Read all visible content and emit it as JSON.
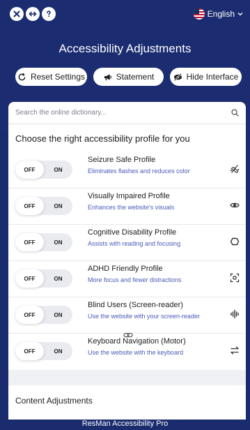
{
  "header": {
    "language": "English",
    "title": "Accessibility Adjustments",
    "buttons": {
      "reset": "Reset Settings",
      "statement": "Statement",
      "hide": "Hide Interface"
    }
  },
  "search": {
    "placeholder": "Search the online dictionary..."
  },
  "profiles": {
    "heading": "Choose the right accessibility profile for you",
    "off_label": "OFF",
    "on_label": "ON",
    "items": [
      {
        "title": "Seizure Safe Profile",
        "description": "Eliminates flashes and reduces color",
        "icon": "lightning-off-icon"
      },
      {
        "title": "Visually Impaired Profile",
        "description": "Enhances the website's visuals",
        "icon": "eye-icon"
      },
      {
        "title": "Cognitive Disability Profile",
        "description": "Assists with reading and focusing",
        "icon": "brain-icon"
      },
      {
        "title": "ADHD Friendly Profile",
        "description": "More focus and fewer distractions",
        "icon": "focus-target-icon"
      },
      {
        "title": "Blind Users (Screen-reader)",
        "description": "Use the website with your screen-reader",
        "icon": "audio-wave-icon"
      },
      {
        "title": "Keyboard Navigation (Motor)",
        "description": "Use the website with the keyboard",
        "icon": "arrows-swap-icon"
      }
    ]
  },
  "content": {
    "heading": "Content Adjustments"
  },
  "footer": {
    "brand": "ResMan Accessibility Pro"
  },
  "colors": {
    "header_bg": "#1b2d70",
    "accent_text": "#4a5bb8",
    "toggle_track": "#e9ebf1"
  }
}
